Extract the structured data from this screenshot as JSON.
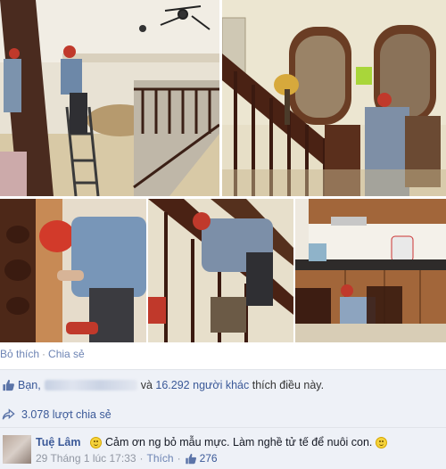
{
  "post": {
    "action_like": "Bỏ thích",
    "action_separator": "·",
    "action_share": "Chia sẻ",
    "likes_prefix": "Bạn,",
    "likes_others": "16.292 người khác",
    "likes_connector": "và",
    "likes_suffix": "thích điều này.",
    "shares_text": "3.078 lượt chia sẻ"
  },
  "comment": {
    "author": "Tuệ Lâm",
    "text": "Cảm ơn ng bỏ mẫu mực. Làm nghề tử tế để nuôi con.",
    "timestamp": "29 Tháng 1 lúc 17:33",
    "separator": "·",
    "like_link": "Thích",
    "like_count": "276"
  },
  "icons": {
    "like": "thumbs-up-icon",
    "share": "share-arrow-icon",
    "emoji": "smiley-icon"
  },
  "colors": {
    "link": "#3b5998",
    "action_link": "#6d84b4",
    "ufi_background": "#eef1f7",
    "meta_gray": "#9197a3"
  }
}
